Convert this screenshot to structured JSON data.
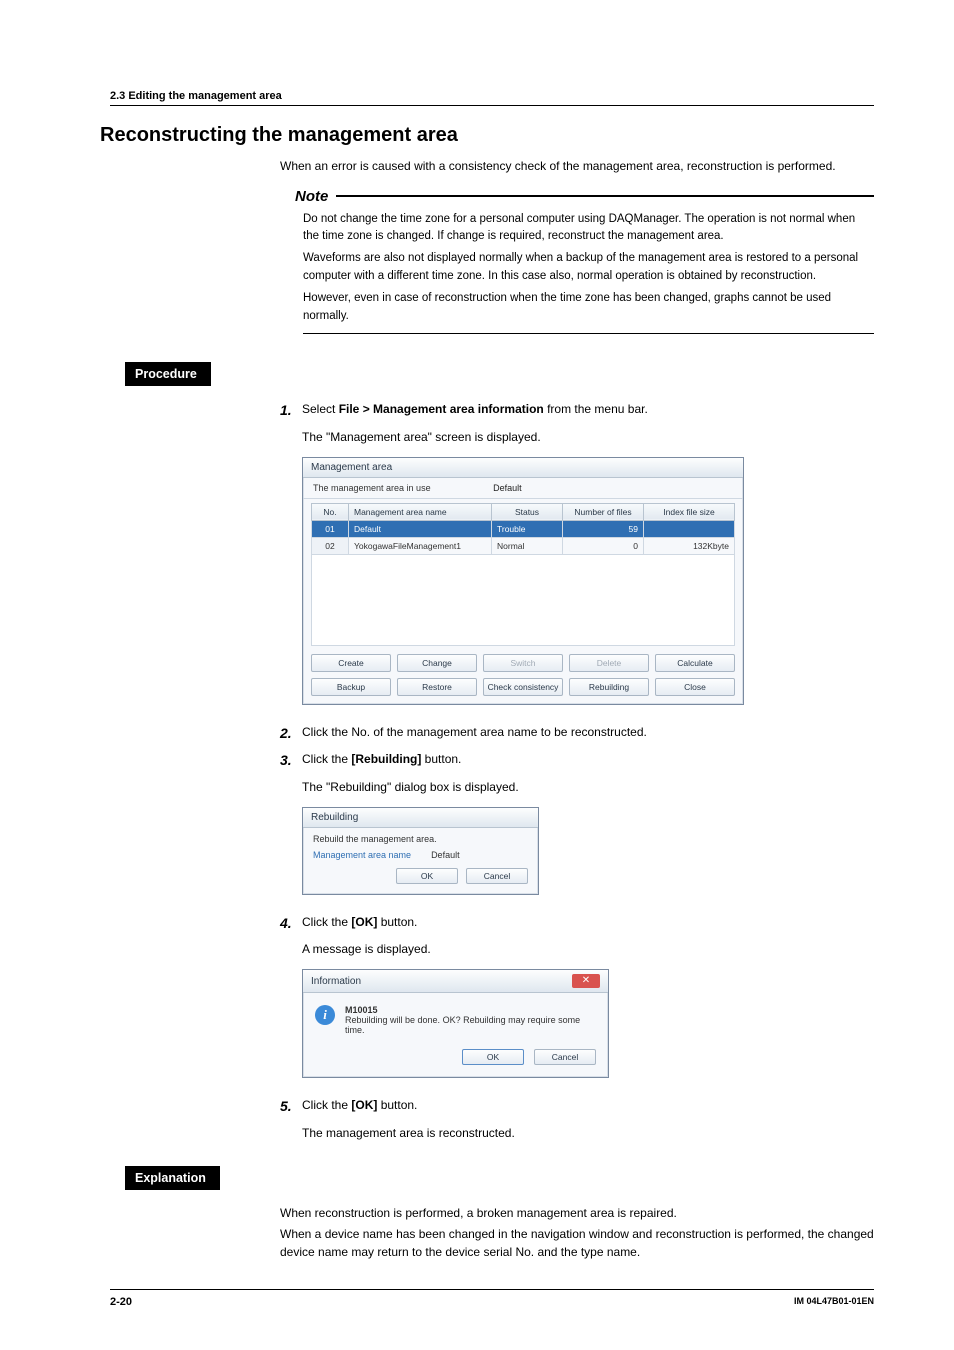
{
  "header": {
    "section": "2.3  Editing the management area"
  },
  "title": "Reconstructing the management area",
  "intro": "When an error is caused with a consistency check of the management area, reconstruction is performed.",
  "note": {
    "label": "Note",
    "p1": "Do not change the time zone for a personal computer using DAQManager. The operation is not normal when the time zone is changed. If change is required, reconstruct the management area.",
    "p2": "Waveforms are also not displayed normally when a backup of the management area is restored to a personal computer with a different time zone. In this case also, normal operation is obtained by reconstruction.",
    "p3": "However, even in case of reconstruction when the time zone has been changed, graphs cannot be used normally."
  },
  "procedure_label": "Procedure",
  "steps": {
    "s1_num": "1.",
    "s1_a": "Select ",
    "s1_b": "File > Management area information",
    "s1_c": " from the menu bar.",
    "s1_sub": "The \"Management area\" screen is displayed.",
    "s2_num": "2.",
    "s2": "Click the No. of the management area name to be reconstructed.",
    "s3_num": "3.",
    "s3_a": "Click the ",
    "s3_b": "[Rebuilding]",
    "s3_c": " button.",
    "s3_sub": "The \"Rebuilding\" dialog box is displayed.",
    "s4_num": "4.",
    "s4_a": "Click the ",
    "s4_b": "[OK]",
    "s4_c": " button.",
    "s4_sub": "A message is displayed.",
    "s5_num": "5.",
    "s5_a": "Click the ",
    "s5_b": "[OK]",
    "s5_c": " button.",
    "s5_sub": "The management area is reconstructed."
  },
  "mg": {
    "title": "Management area",
    "inuse_label": "The management area in use",
    "inuse_value": "Default",
    "cols": {
      "no": "No.",
      "name": "Management area name",
      "status": "Status",
      "nfiles": "Number of files",
      "idx": "Index file size"
    },
    "rows": [
      {
        "no": "01",
        "name": "Default",
        "status": "Trouble",
        "nfiles": "59",
        "idx": ""
      },
      {
        "no": "02",
        "name": "YokogawaFileManagement1",
        "status": "Normal",
        "nfiles": "0",
        "idx": "132Kbyte"
      }
    ],
    "btns": {
      "create": "Create",
      "change": "Change",
      "switch": "Switch",
      "delete": "Delete",
      "calculate": "Calculate",
      "backup": "Backup",
      "restore": "Restore",
      "check": "Check consistency",
      "rebuilding": "Rebuilding",
      "close": "Close"
    }
  },
  "rb": {
    "title": "Rebuilding",
    "label": "Rebuild the management area.",
    "name_k": "Management area name",
    "name_v": "Default",
    "ok": "OK",
    "cancel": "Cancel"
  },
  "info": {
    "title": "Information",
    "code": "M10015",
    "msg": "Rebuilding will be done. OK? Rebuilding may require some time.",
    "ok": "OK",
    "cancel": "Cancel"
  },
  "explanation_label": "Explanation",
  "explanation": {
    "p1": "When reconstruction is performed, a broken management area is repaired.",
    "p2": "When a device name has been changed in the navigation window and reconstruction is performed, the changed device name may return to the device serial No. and the type name."
  },
  "footer": {
    "page": "2-20",
    "doc": "IM 04L47B01-01EN"
  }
}
